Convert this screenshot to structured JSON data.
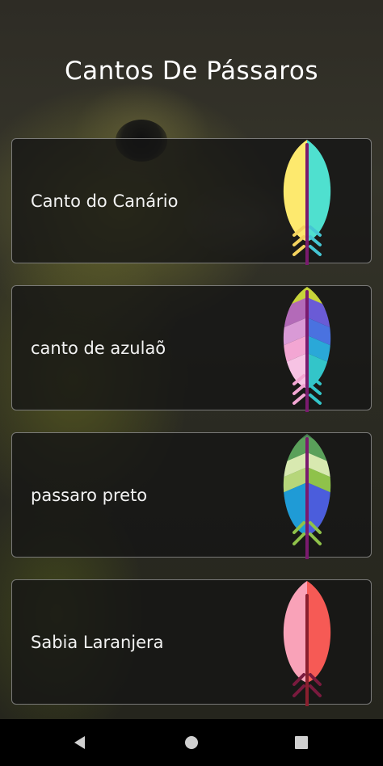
{
  "header": {
    "title": "Cantos De Pássaros"
  },
  "songs": [
    {
      "label": "Canto do Canário",
      "icon": "feather-yellow-cyan-icon"
    },
    {
      "label": "canto de azulaõ",
      "icon": "feather-rainbow-icon"
    },
    {
      "label": "passaro preto",
      "icon": "feather-green-blue-icon"
    },
    {
      "label": "Sabia Laranjera",
      "icon": "feather-pink-red-icon"
    }
  ],
  "navbar": {
    "back": "back-icon",
    "home": "home-icon",
    "recents": "recents-icon"
  },
  "colors": {
    "card_background": "#141414",
    "card_border": "#c8c8c8",
    "text": "#ffffff",
    "navbar": "#000000"
  }
}
